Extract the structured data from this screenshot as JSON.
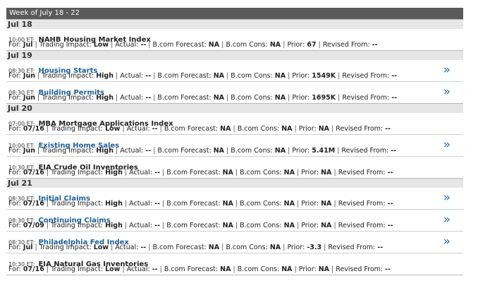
{
  "week_title": "Week of July 18 - 22",
  "labels": {
    "for": "For:",
    "impact": "Trading Impact:",
    "actual": "Actual:",
    "forecast": "B.com Forecast:",
    "cons": "B.com Cons:",
    "prior": "Prior:",
    "revised": "Revised From:",
    "sep": "|"
  },
  "chevron": "»",
  "days": [
    {
      "label": "Jul 18",
      "events": [
        {
          "time": "10:00 ET:",
          "name": "NAHB Housing Market Index",
          "link": false,
          "chevron": false,
          "for": "Jul",
          "impact": "Low",
          "actual": "--",
          "forecast": "NA",
          "cons": "NA",
          "prior": "67",
          "revised": "--"
        }
      ]
    },
    {
      "label": "Jul 19",
      "events": [
        {
          "time": "08:30 ET:",
          "name": "Housing Starts",
          "link": true,
          "chevron": true,
          "for": "Jun",
          "impact": "High",
          "actual": "--",
          "forecast": "NA",
          "cons": "NA",
          "prior": "1549K",
          "revised": "--"
        },
        {
          "time": "08:30 ET:",
          "name": "Building Permits",
          "link": true,
          "chevron": true,
          "for": "Jun",
          "impact": "High",
          "actual": "--",
          "forecast": "NA",
          "cons": "NA",
          "prior": "1695K",
          "revised": "--"
        }
      ]
    },
    {
      "label": "Jul 20",
      "events": [
        {
          "time": "07:00 ET:",
          "name": "MBA Mortgage Applications Index",
          "link": false,
          "chevron": false,
          "for": "07/16",
          "impact": "Low",
          "actual": "--",
          "forecast": "NA",
          "cons": "NA",
          "prior": "NA",
          "revised": "--"
        },
        {
          "time": "10:00 ET:",
          "name": "Existing Home Sales",
          "link": true,
          "chevron": true,
          "for": "Jun",
          "impact": "High",
          "actual": "--",
          "forecast": "NA",
          "cons": "NA",
          "prior": "5.41M",
          "revised": "--"
        },
        {
          "time": "10:30 ET:",
          "name": "EIA Crude Oil Inventories",
          "link": false,
          "chevron": false,
          "for": "07/16",
          "impact": "High",
          "actual": "--",
          "forecast": "NA",
          "cons": "NA",
          "prior": "NA",
          "revised": "--"
        }
      ]
    },
    {
      "label": "Jul 21",
      "events": [
        {
          "time": "08:30 ET:",
          "name": "Initial Claims",
          "link": true,
          "chevron": true,
          "for": "07/16",
          "impact": "High",
          "actual": "--",
          "forecast": "NA",
          "cons": "NA",
          "prior": "NA",
          "revised": "--"
        },
        {
          "time": "08:30 ET:",
          "name": "Continuing Claims",
          "link": true,
          "chevron": true,
          "for": "07/09",
          "impact": "High",
          "actual": "--",
          "forecast": "NA",
          "cons": "NA",
          "prior": "NA",
          "revised": "--"
        },
        {
          "time": "08:30 ET:",
          "name": "Philadelphia Fed Index",
          "link": true,
          "chevron": true,
          "for": "Jul",
          "impact": "Low",
          "actual": "--",
          "forecast": "NA",
          "cons": "NA",
          "prior": "-3.3",
          "revised": "--"
        },
        {
          "time": "10:30 ET:",
          "name": "EIA Natural Gas Inventories",
          "link": false,
          "chevron": false,
          "for": "07/16",
          "impact": "Low",
          "actual": "--",
          "forecast": "NA",
          "cons": "NA",
          "prior": "NA",
          "revised": "--"
        }
      ]
    }
  ]
}
